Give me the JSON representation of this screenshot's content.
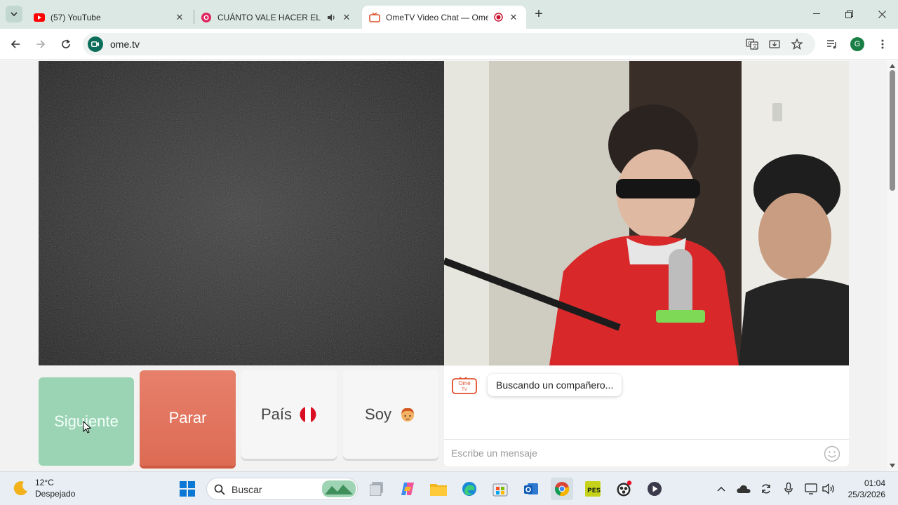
{
  "browser": {
    "tabs": [
      {
        "title": "(57) YouTube",
        "active": false
      },
      {
        "title": "CUÁNTO VALE HACER EL AMOR",
        "active": false,
        "audio": true
      },
      {
        "title": "OmeTV Video Chat — Omegle",
        "active": true,
        "recording": true
      }
    ],
    "url": "ome.tv",
    "profile_initial": "G"
  },
  "ometv": {
    "buttons": {
      "next": "Siguiente",
      "stop": "Parar",
      "country": "País",
      "gender": "Soy"
    },
    "country_flag": "peru-flag",
    "gender_icon": "boy-emoji",
    "chat": {
      "logo_line1": "Ome",
      "logo_line2": "TV",
      "status_message": "Buscando un compañero...",
      "input_placeholder": "Escribe un mensaje"
    }
  },
  "taskbar": {
    "weather": {
      "temp": "12°C",
      "condition": "Despejado"
    },
    "search_label": "Buscar",
    "clock": {
      "time": "01:04",
      "date": "25/3/2026"
    }
  },
  "colors": {
    "next_green": "#9bd4b4",
    "stop_red": "#e27660",
    "tab_strip": "#dbe8e4"
  }
}
